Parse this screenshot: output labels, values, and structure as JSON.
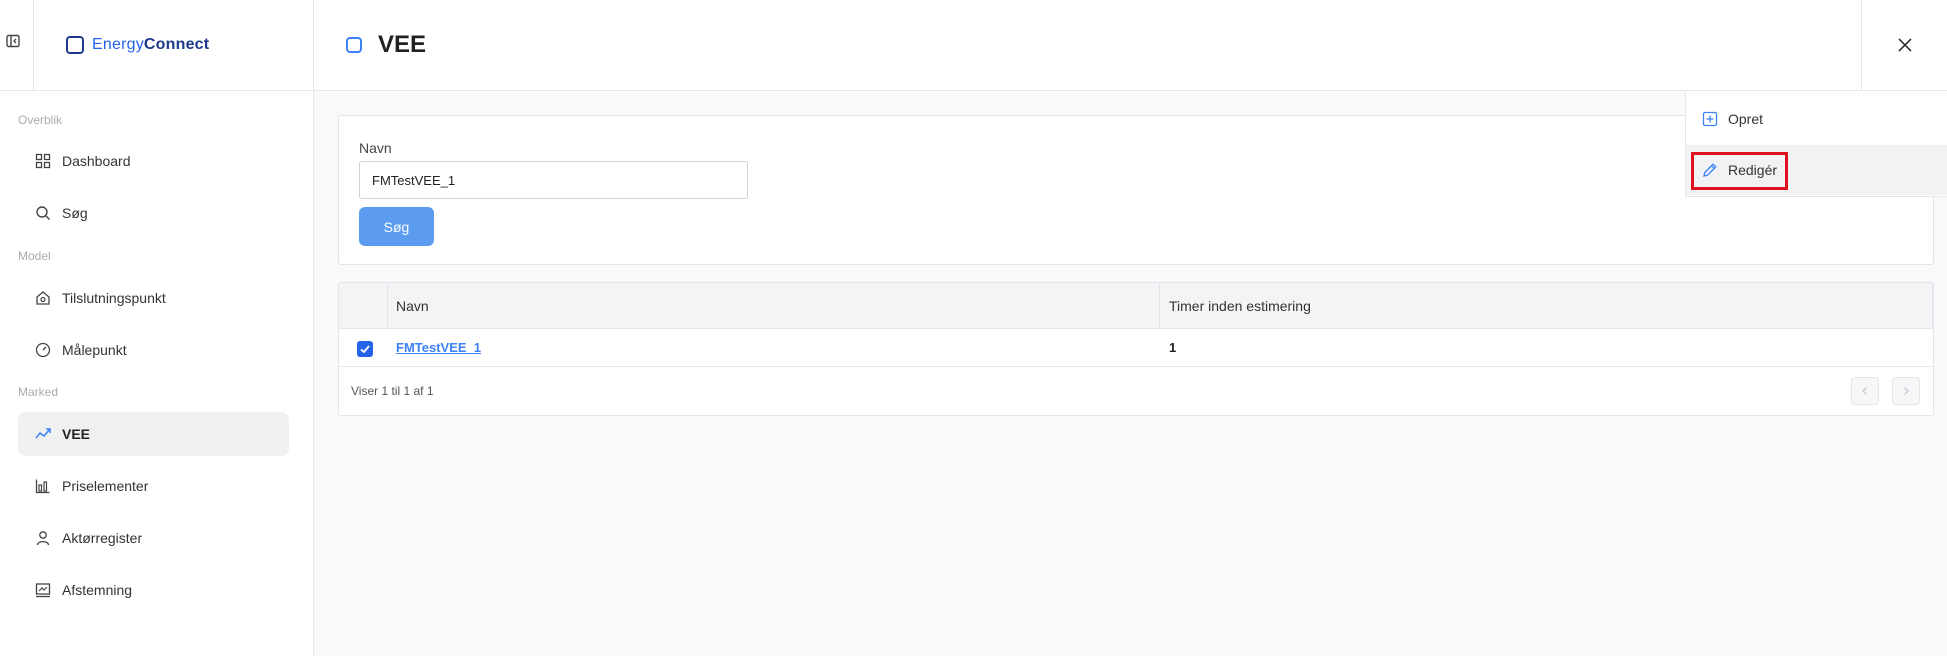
{
  "app": {
    "brand_name_part1": "Energy",
    "brand_name_part2": "Connect"
  },
  "header": {
    "title": "VEE"
  },
  "sidebar": {
    "sections": [
      {
        "label": "Overblik"
      },
      {
        "label": "Model"
      },
      {
        "label": "Marked"
      }
    ],
    "items": [
      {
        "label": "Dashboard",
        "icon": "grid-icon"
      },
      {
        "label": "Søg",
        "icon": "search-icon"
      },
      {
        "label": "Tilslutningspunkt",
        "icon": "house-icon"
      },
      {
        "label": "Målepunkt",
        "icon": "gauge-icon"
      },
      {
        "label": "VEE",
        "icon": "trend-icon",
        "active": true
      },
      {
        "label": "Priselementer",
        "icon": "price-chart-icon"
      },
      {
        "label": "Aktørregister",
        "icon": "person-icon"
      },
      {
        "label": "Afstemning",
        "icon": "reconcile-icon"
      }
    ]
  },
  "search": {
    "field_label": "Navn",
    "field_value": "FMTestVEE_1",
    "button_label": "Søg"
  },
  "table": {
    "columns": [
      "Navn",
      "Timer inden estimering"
    ],
    "rows": [
      {
        "name": "FMTestVEE_1",
        "hours": "1",
        "checked": true
      }
    ],
    "footer": "Viser 1 til 1 af 1"
  },
  "actions": {
    "create_label": "Opret",
    "edit_label": "Redigér"
  },
  "colors": {
    "brand": "#1e3a8a",
    "accent": "#3b82f6",
    "button": "#5b9cf0",
    "highlight": "#e1101f"
  }
}
